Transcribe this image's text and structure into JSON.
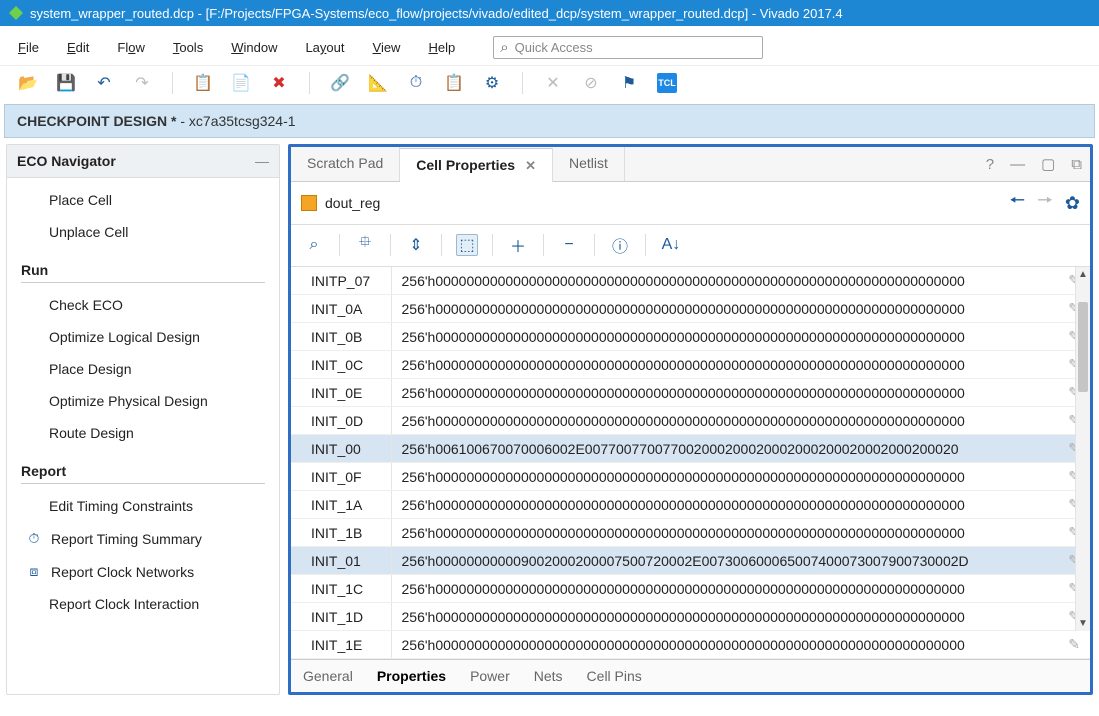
{
  "title": "system_wrapper_routed.dcp - [F:/Projects/FPGA-Systems/eco_flow/projects/vivado/edited_dcp/system_wrapper_routed.dcp] - Vivado 2017.4",
  "menu": {
    "file": "File",
    "edit": "Edit",
    "flow": "Flow",
    "tools": "Tools",
    "window": "Window",
    "layout": "Layout",
    "view": "View",
    "help": "Help",
    "quick_access_placeholder": "Quick Access"
  },
  "context_banner": {
    "label": "CHECKPOINT DESIGN *",
    "suffix": " - xc7a35tcsg324-1"
  },
  "eco": {
    "title": "ECO Navigator",
    "top_items": [
      "Place Cell",
      "Unplace Cell"
    ],
    "sections": [
      {
        "label": "Run",
        "items": [
          {
            "text": "Check ECO",
            "icon": ""
          },
          {
            "text": "Optimize Logical Design",
            "icon": ""
          },
          {
            "text": "Place Design",
            "icon": ""
          },
          {
            "text": "Optimize Physical Design",
            "icon": ""
          },
          {
            "text": "Route Design",
            "icon": ""
          }
        ]
      },
      {
        "label": "Report",
        "items": [
          {
            "text": "Edit Timing Constraints",
            "icon": ""
          },
          {
            "text": "Report Timing Summary",
            "icon": "clock"
          },
          {
            "text": "Report Clock Networks",
            "icon": "nets"
          },
          {
            "text": "Report Clock Interaction",
            "icon": ""
          }
        ]
      }
    ]
  },
  "panel": {
    "tabs": [
      "Scratch Pad",
      "Cell Properties",
      "Netlist"
    ],
    "active_tab_index": 1,
    "cell_name": "dout_reg",
    "rows": [
      {
        "name": "INITP_07",
        "value": "256'h00000000000000000000000000000000000000000000000000000000000000000000",
        "selected": false
      },
      {
        "name": "INIT_0A",
        "value": "256'h00000000000000000000000000000000000000000000000000000000000000000000",
        "selected": false
      },
      {
        "name": "INIT_0B",
        "value": "256'h00000000000000000000000000000000000000000000000000000000000000000000",
        "selected": false
      },
      {
        "name": "INIT_0C",
        "value": "256'h00000000000000000000000000000000000000000000000000000000000000000000",
        "selected": false
      },
      {
        "name": "INIT_0E",
        "value": "256'h00000000000000000000000000000000000000000000000000000000000000000000",
        "selected": false
      },
      {
        "name": "INIT_0D",
        "value": "256'h00000000000000000000000000000000000000000000000000000000000000000000",
        "selected": false
      },
      {
        "name": "INIT_00",
        "value": "256'h006100670070006002E007700770077002000200020002000200020002000200020",
        "selected": true
      },
      {
        "name": "INIT_0F",
        "value": "256'h00000000000000000000000000000000000000000000000000000000000000000000",
        "selected": false
      },
      {
        "name": "INIT_1A",
        "value": "256'h00000000000000000000000000000000000000000000000000000000000000000000",
        "selected": false
      },
      {
        "name": "INIT_1B",
        "value": "256'h00000000000000000000000000000000000000000000000000000000000000000000",
        "selected": false
      },
      {
        "name": "INIT_01",
        "value": "256'h000000000009002000200007500720002E007300600065007400073007900730002D",
        "selected": true
      },
      {
        "name": "INIT_1C",
        "value": "256'h00000000000000000000000000000000000000000000000000000000000000000000",
        "selected": false
      },
      {
        "name": "INIT_1D",
        "value": "256'h00000000000000000000000000000000000000000000000000000000000000000000",
        "selected": false
      },
      {
        "name": "INIT_1E",
        "value": "256'h00000000000000000000000000000000000000000000000000000000000000000000",
        "selected": false
      }
    ],
    "bottom_tabs": [
      "General",
      "Properties",
      "Power",
      "Nets",
      "Cell Pins"
    ],
    "bottom_active_index": 1
  }
}
